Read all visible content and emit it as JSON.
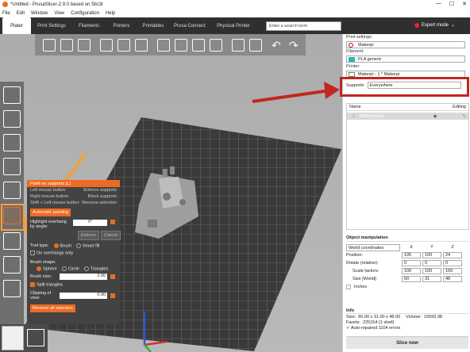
{
  "window": {
    "title": "*Untitled - PrusaSlicer-2.9.0 based on Slic3r",
    "controls": [
      "—",
      "☐",
      "✕"
    ]
  },
  "menu": [
    "File",
    "Edit",
    "Window",
    "View",
    "Configuration",
    "Help"
  ],
  "tabs": [
    "Plater",
    "Print Settings",
    "Filaments",
    "Printers",
    "Printables",
    "Prusa Connect",
    "Physical Printer"
  ],
  "search": {
    "placeholder": "Enter a search term"
  },
  "mode": {
    "label": "Expert mode",
    "color": "#e2232a"
  },
  "gizmo_panel": {
    "header": "Paint-on supports [L]",
    "hints": [
      {
        "action": "Left mouse button:",
        "effect": "Enforce supports"
      },
      {
        "action": "Right mouse button:",
        "effect": "Block supports"
      },
      {
        "action": "Shift + Left mouse button:",
        "effect": "Remove selection"
      }
    ],
    "automatic_painting": "Automatic painting",
    "highlight_label": "Highlight overhang by angle:",
    "angle_value": "0°",
    "enforce_button": "Enforce",
    "cancel_button": "Cancel",
    "tool_type_label": "Tool type:",
    "tool_brush": "Brush",
    "tool_smart_fill": "Smart fill",
    "on_overhangs_only": "On overhangs only",
    "brush_shape_label": "Brush shape:",
    "shape_sphere": "Sphere",
    "shape_circle": "Circle",
    "shape_triangles": "Triangles",
    "brush_size_label": "Brush size:",
    "brush_size_value": "2.00",
    "split_triangles": "Split triangles",
    "clipping_label": "Clipping of view:",
    "clipping_value": "0.00",
    "remove_all": "Remove all selection"
  },
  "sidebar": {
    "print_settings_label": "Print settings:",
    "print_profile": "Makerpi",
    "filament_label": "Filament:",
    "filament_profile": "PLA generic",
    "filament_color": "#2bb7b3",
    "printer_label": "Printer:",
    "printer_profile": "Makerpi - 1 * Makerpi",
    "supports_label": "Supports:",
    "supports_value": "Everywhere",
    "list_header_name": "Name",
    "list_header_editing": "Editing",
    "object_name": "3DBenchy.stl",
    "object_manipulation": "Object manipulation",
    "coord_system": "World coordinates",
    "axes": [
      "X",
      "Y",
      "Z"
    ],
    "position_label": "Position:",
    "position": [
      "105",
      "100",
      "24"
    ],
    "rotate_label": "Rotate (relative):",
    "rotate": [
      "0",
      "0",
      "0"
    ],
    "scale_label": "Scale factors:",
    "scale": [
      "100",
      "100",
      "100"
    ],
    "size_label": "Size [World]:",
    "size": [
      "60",
      "31",
      "48"
    ],
    "inches_label": "Inches",
    "info_title": "Info",
    "info_size_label": "Size:",
    "info_size": "60.00 x 31.00 x 48.00",
    "info_volume_label": "Volume:",
    "info_volume": "15550.38",
    "info_facets_label": "Facets:",
    "info_facets": "225154 (1 shell)",
    "info_repair": "Auto-repaired 1104 errors",
    "slice_button": "Slice now"
  },
  "annotation": {
    "orange_arrow_color": "#f2a040",
    "red_arrow_color": "#c0281f"
  }
}
